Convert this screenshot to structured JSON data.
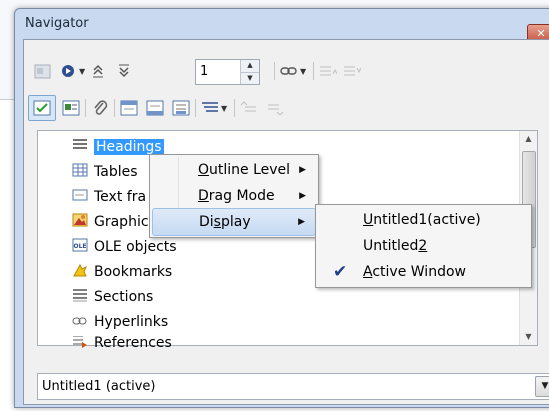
{
  "window": {
    "title": "Navigator",
    "close_glyph": "✕"
  },
  "toolbar1": {
    "icons": [
      "navigator-toggle-icon",
      "navigation-icon",
      "previous-icon",
      "next-icon"
    ],
    "spin_value": "1",
    "link_icon": "link-icon",
    "dim_icons": [
      "promote-level-icon",
      "demote-level-icon"
    ]
  },
  "toolbar2": {
    "icons": [
      "content-view-icon",
      "set-reminder-icon",
      "paperclip-icon",
      "header-icon",
      "footer-icon",
      "anchor-icon",
      "heading-levels-icon",
      "promote-chapter-icon",
      "demote-chapter-icon"
    ]
  },
  "tree": {
    "items": [
      {
        "label": "Headings",
        "icon": "headings-icon",
        "selected": true
      },
      {
        "label": "Tables",
        "icon": "tables-icon"
      },
      {
        "label": "Text fra",
        "icon": "text-frame-icon"
      },
      {
        "label": "Graphic",
        "icon": "graphics-icon"
      },
      {
        "label": "OLE objects",
        "icon": "ole-icon"
      },
      {
        "label": "Bookmarks",
        "icon": "bookmark-icon"
      },
      {
        "label": "Sections",
        "icon": "sections-icon"
      },
      {
        "label": "Hyperlinks",
        "icon": "hyperlink-icon"
      },
      {
        "label": "References",
        "icon": "references-icon"
      }
    ]
  },
  "context_menu": {
    "items": [
      {
        "label_u": "O",
        "label_rest": "utline Level",
        "has_submenu": true
      },
      {
        "label_u": "D",
        "label_rest": "rag Mode",
        "has_submenu": true
      },
      {
        "label_pre": "Di",
        "label_u": "s",
        "label_rest": "play",
        "has_submenu": true,
        "highlighted": true
      }
    ],
    "submenu_arrow": "▶"
  },
  "display_submenu": {
    "items": [
      {
        "label_u": "U",
        "label_rest": "ntitled1(active)"
      },
      {
        "label_pre": "Untitled",
        "label_u": "2",
        "label_rest": ""
      },
      {
        "label_u": "A",
        "label_rest": "ctive Window",
        "checked": true,
        "check_glyph": "✔"
      }
    ]
  },
  "document_combo": {
    "value": "Untitled1 (active)",
    "arrow": "▼"
  },
  "scrollbar": {
    "up": "▲",
    "down": "▼"
  }
}
